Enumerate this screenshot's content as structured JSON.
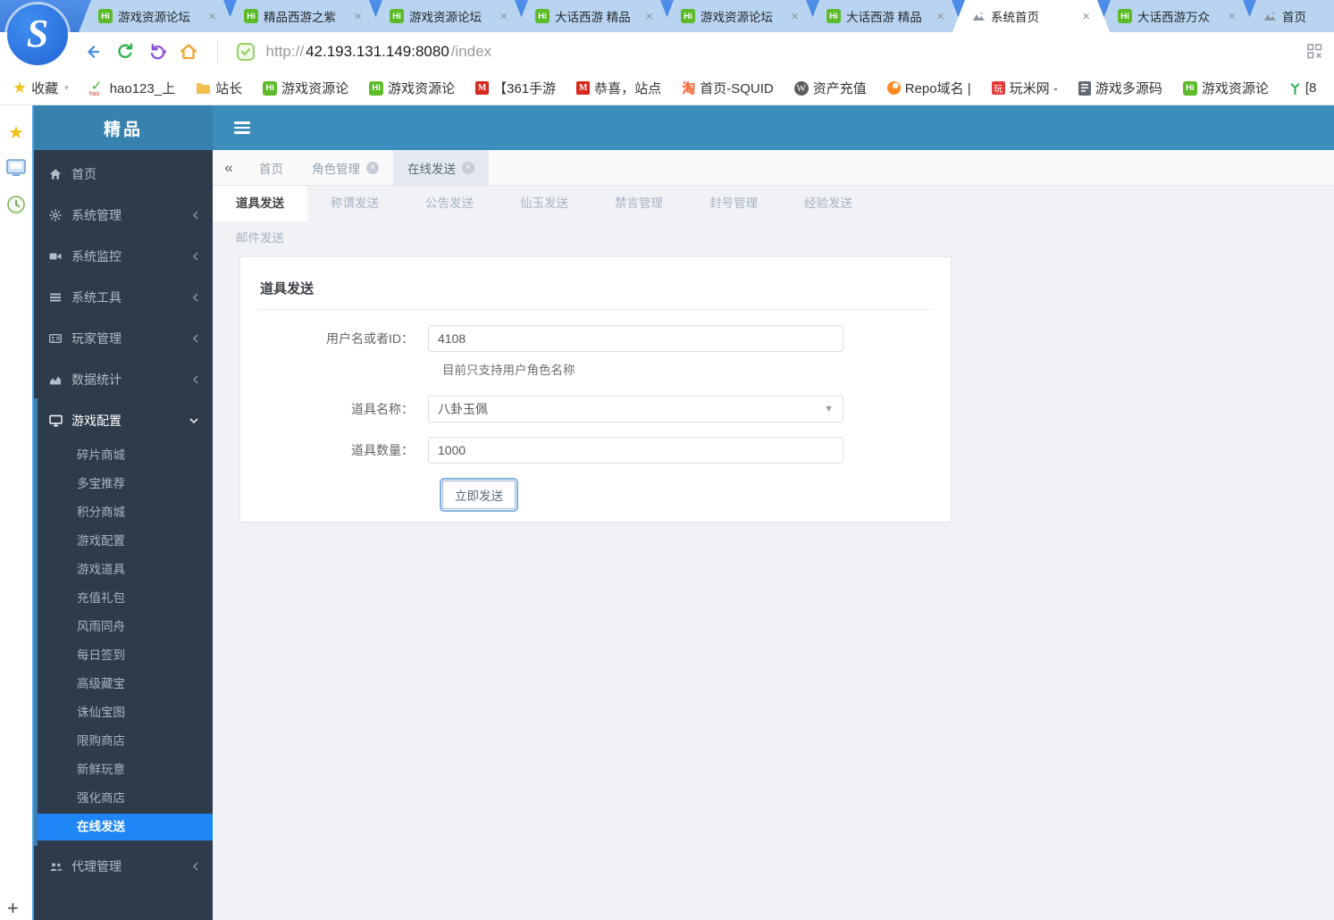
{
  "browser": {
    "tabs": [
      {
        "title": "游戏资源论坛",
        "icon": "hi-favicon"
      },
      {
        "title": "精品西游之紫",
        "icon": "hi-favicon"
      },
      {
        "title": "游戏资源论坛",
        "icon": "hi-favicon"
      },
      {
        "title": "大话西游 精品",
        "icon": "hi-favicon"
      },
      {
        "title": "游戏资源论坛",
        "icon": "hi-favicon"
      },
      {
        "title": "大话西游 精品",
        "icon": "hi-favicon"
      },
      {
        "title": "系统首页",
        "icon": "mountain-favicon",
        "active": true
      },
      {
        "title": "大话西游万众",
        "icon": "hi-favicon"
      },
      {
        "title": "首页",
        "icon": "mountain-favicon"
      }
    ],
    "url": {
      "scheme": "http://",
      "host": "42.193.131.149:8080",
      "path": "/index"
    },
    "bookmarks": [
      {
        "label": "收藏",
        "icon": "star-icon"
      },
      {
        "label": "hao123_上",
        "icon": "hao123-icon"
      },
      {
        "label": "站长",
        "icon": "folder-icon"
      },
      {
        "label": "游戏资源论",
        "icon": "hi-icon"
      },
      {
        "label": "游戏资源论",
        "icon": "hi-icon"
      },
      {
        "label": "【361手游",
        "icon": "m-icon"
      },
      {
        "label": "恭喜，站点",
        "icon": "m-icon"
      },
      {
        "label": "首页-SQUID",
        "icon": "taobao-icon"
      },
      {
        "label": "资产充值",
        "icon": "wordpress-icon"
      },
      {
        "label": "Repo域名 |",
        "icon": "repo-icon"
      },
      {
        "label": "玩米网 -",
        "icon": "wanmi-icon"
      },
      {
        "label": "游戏多源码",
        "icon": "code-icon"
      },
      {
        "label": "游戏资源论",
        "icon": "hi-icon"
      },
      {
        "label": "[8",
        "icon": "branch-icon"
      }
    ]
  },
  "app": {
    "brand": "精品",
    "menu": [
      {
        "label": "首页",
        "icon": "home-icon"
      },
      {
        "label": "系统管理",
        "icon": "gear-icon"
      },
      {
        "label": "系统监控",
        "icon": "camera-icon"
      },
      {
        "label": "系统工具",
        "icon": "bars-icon"
      },
      {
        "label": "玩家管理",
        "icon": "idcard-icon"
      },
      {
        "label": "数据统计",
        "icon": "chart-icon"
      },
      {
        "label": "游戏配置",
        "icon": "desktop-icon",
        "expanded": true
      },
      {
        "label": "代理管理",
        "icon": "users-icon"
      }
    ],
    "game_config_children": [
      "碎片商城",
      "多宝推荐",
      "积分商城",
      "游戏配置",
      "游戏道具",
      "充值礼包",
      "风雨同舟",
      "每日签到",
      "高级藏宝",
      "诛仙宝图",
      "限购商店",
      "新鲜玩意",
      "强化商店",
      "在线发送"
    ],
    "active_child": "在线发送",
    "crumbs": [
      "首页",
      "角色管理",
      "在线发送"
    ],
    "subtabs_row1": [
      "道具发送",
      "称谓发送",
      "公告发送",
      "仙玉发送",
      "禁言管理",
      "封号管理",
      "经验发送"
    ],
    "subtabs_row2": [
      "邮件发送"
    ],
    "active_subtab": "道具发送",
    "form": {
      "title": "道具发送",
      "user_label": "用户名或者ID：",
      "user_value": "4108",
      "user_help": "目前只支持用户角色名称",
      "item_label": "道具名称：",
      "item_value": "八卦玉佩",
      "qty_label": "道具数量：",
      "qty_value": "1000",
      "submit_label": "立即发送"
    }
  }
}
